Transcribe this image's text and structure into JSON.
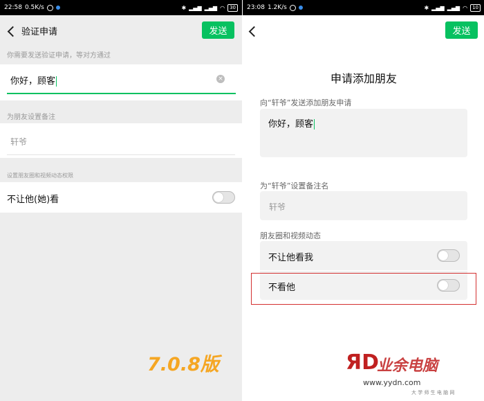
{
  "left": {
    "statusbar": {
      "time": "22:58",
      "speed": "0.5K/s",
      "battery": "30"
    },
    "header": {
      "title": "验证申请",
      "send_label": "发送"
    },
    "hint": "你需要发送验证申请，等对方通过",
    "message": "你好，顾客",
    "remark_label": "为朋友设置备注",
    "remark_value": "轩爷",
    "permission_label": "设置朋友圈和视频动态权限",
    "permission_item": "不让他(她)看",
    "toggle_on": false,
    "version_label": "7.0.8版"
  },
  "right": {
    "statusbar": {
      "time": "23:08",
      "speed": "1.2K/s",
      "battery": "10"
    },
    "send_label": "发送",
    "title": "申请添加朋友",
    "message_label": "向“轩爷”发送添加朋友申请",
    "message": "你好，顾客",
    "remark_label": "为“轩爷”设置备注名",
    "remark_value": "轩爷",
    "moments_label": "朋友圈和视频动态",
    "items": [
      {
        "label": "不让他看我",
        "on": false
      },
      {
        "label": "不看他",
        "on": false
      }
    ]
  },
  "watermark": {
    "cn_text": "业余电脑",
    "url": "www.yydn.com",
    "sub": "大 学 师 生 电 脑 网"
  },
  "colors": {
    "accent": "#07c160",
    "version": "#f5a623",
    "highlight": "#d32f2f"
  }
}
